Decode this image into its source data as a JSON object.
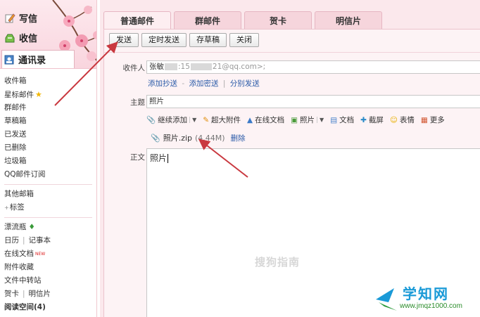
{
  "sidebar": {
    "top": {
      "write": "写信",
      "inbox": "收信",
      "contacts": "通讯录"
    },
    "folders": {
      "inbox": "收件箱",
      "starred": "星标邮件",
      "group": "群邮件",
      "drafts": "草稿箱",
      "sent": "已发送",
      "deleted": "已删除",
      "trash": "垃圾箱",
      "subscribe": "QQ邮件订阅",
      "other": "其他邮箱",
      "tags": "标签",
      "bottle": "漂流瓶",
      "calendar": "日历",
      "notes": "记事本",
      "docs": "在线文档",
      "docs_badge": "NEW",
      "collection": "附件收藏",
      "transfer": "文件中转站",
      "greeting": "贺卡",
      "postcard": "明信片",
      "reading": "阅读空间(4)"
    }
  },
  "tabs": [
    "普通邮件",
    "群邮件",
    "贺卡",
    "明信片"
  ],
  "toolbar": {
    "send": "发送",
    "scheduled": "定时发送",
    "save_draft": "存草稿",
    "close": "关闭"
  },
  "form": {
    "recipient_label": "收件人",
    "recipient_name": "张敏",
    "recipient_part1": ":15",
    "recipient_part2": "21@qq.com>;",
    "add_cc": "添加抄送",
    "dash": "-",
    "add_bcc": "添加密送",
    "pipe": "|",
    "separate_send": "分别发送",
    "subject_label": "主题",
    "subject_value": "照片",
    "attach_tools": {
      "continue_add": "继续添加",
      "super_attach": "超大附件",
      "online_doc": "在线文档",
      "photo": "照片",
      "document": "文档",
      "screenshot": "截屏",
      "emoji": "表情",
      "more": "更多"
    },
    "attachment": {
      "filename": "照片.zip",
      "size": "(4.44M)",
      "delete": "删除"
    },
    "body_label": "正文",
    "body_text": "照片"
  },
  "watermark": "搜狗指南",
  "logo": {
    "name": "学知网",
    "url": "www.jmqz1000.com"
  },
  "colors": {
    "accent_pink": "#fbe8ec",
    "link_blue": "#2a5aa8",
    "arrow_red": "#c9383f"
  }
}
